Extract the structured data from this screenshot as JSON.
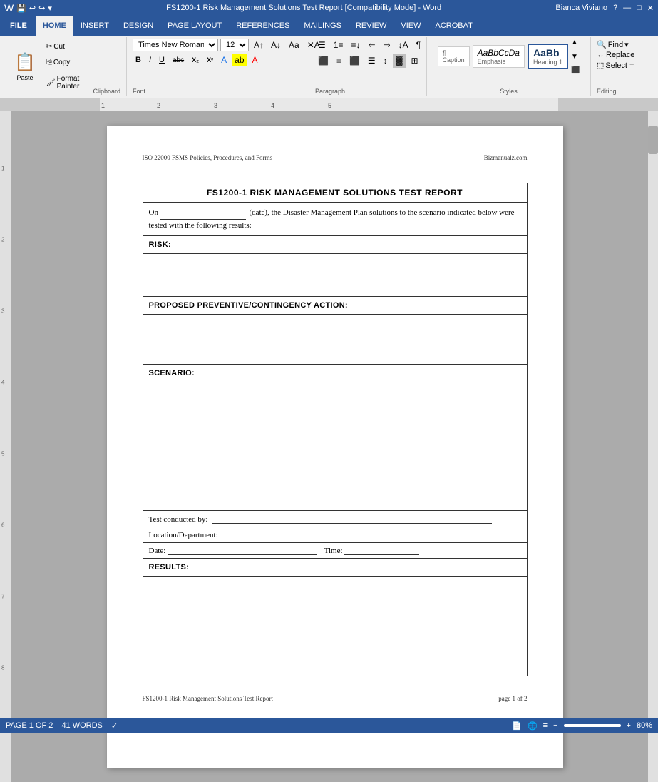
{
  "titleBar": {
    "title": "FS1200-1 Risk Management Solutions Test Report [Compatibility Mode] - Word",
    "user": "Bianca Viviano",
    "buttons": [
      "?",
      "—",
      "□",
      "✕"
    ]
  },
  "ribbon": {
    "tabs": [
      "FILE",
      "HOME",
      "INSERT",
      "DESIGN",
      "PAGE LAYOUT",
      "REFERENCES",
      "MAILINGS",
      "REVIEW",
      "VIEW",
      "ACROBAT"
    ],
    "activeTab": "HOME",
    "font": {
      "name": "Times New Roman",
      "size": "12",
      "label": "Font"
    },
    "paragraphLabel": "Paragraph",
    "stylesLabel": "Styles",
    "editingLabel": "Editing",
    "clipboardLabel": "Clipboard",
    "styles": [
      {
        "name": "Caption",
        "label": "¶ Caption"
      },
      {
        "name": "Emphasis",
        "label": "Emphasis"
      },
      {
        "name": "Heading1",
        "label": "AaBbCc"
      }
    ],
    "editing": {
      "find": "Find",
      "replace": "Replace",
      "select": "Select ="
    }
  },
  "page": {
    "headerLeft": "ISO 22000 FSMS Policies, Procedures, and Forms",
    "headerRight": "Bizmanualz.com",
    "title": "FS1200-1 RISK MANAGEMENT SOLUTIONS TEST REPORT",
    "introText": "On",
    "introDate": "(date), the Disaster Management Plan solutions to the scenario indicated below were tested with the following results:",
    "sections": {
      "risk": "RISK:",
      "proposedAction": "PROPOSED PREVENTIVE/CONTINGENCY ACTION:",
      "scenario": "SCENARIO:",
      "testConductedBy": "Test conducted by:",
      "locationDept": "Location/Department:",
      "date": "Date:",
      "time": "Time:",
      "results": "RESULTS:"
    },
    "footerLeft": "FS1200-1 Risk Management Solutions Test Report",
    "footerRight": "page 1 of 2"
  },
  "statusBar": {
    "pageInfo": "PAGE 1 OF 2",
    "wordCount": "41 WORDS",
    "zoom": "80%"
  }
}
